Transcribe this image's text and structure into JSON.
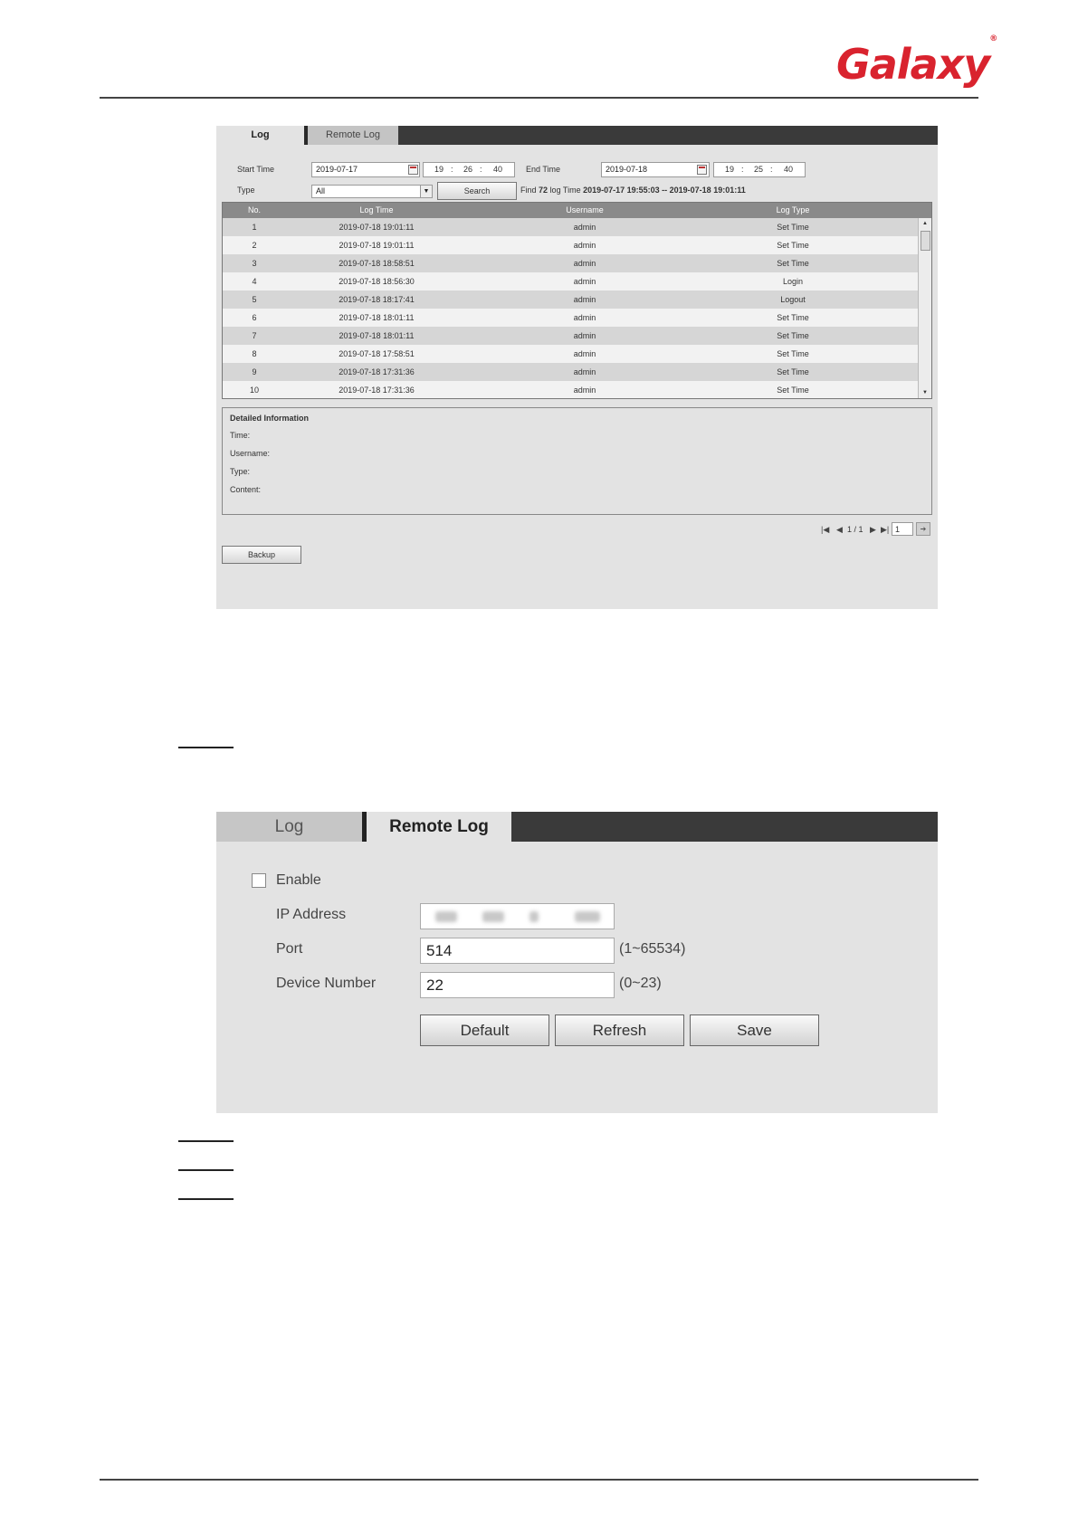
{
  "logo": {
    "text": "Galaxy",
    "mark": "®"
  },
  "log_panel": {
    "tabs": [
      "Log",
      "Remote Log"
    ],
    "start_time_label": "Start Time",
    "start_date": "2019-07-17",
    "start_time": {
      "h": "19",
      "m": "26",
      "s": "40"
    },
    "end_time_label": "End Time",
    "end_date": "2019-07-18",
    "end_time": {
      "h": "19",
      "m": "25",
      "s": "40"
    },
    "type_label": "Type",
    "type_value": "All",
    "search_label": "Search",
    "find_prefix": "Find",
    "find_count": "72",
    "find_middle": "log Time",
    "find_range": "2019-07-17 19:55:03 -- 2019-07-18 19:01:11",
    "columns": [
      "No.",
      "Log Time",
      "Username",
      "Log Type"
    ],
    "rows": [
      [
        "1",
        "2019-07-18 19:01:11",
        "admin",
        "Set Time"
      ],
      [
        "2",
        "2019-07-18 19:01:11",
        "admin",
        "Set Time"
      ],
      [
        "3",
        "2019-07-18 18:58:51",
        "admin",
        "Set Time"
      ],
      [
        "4",
        "2019-07-18 18:56:30",
        "admin",
        "Login"
      ],
      [
        "5",
        "2019-07-18 18:17:41",
        "admin",
        "Logout"
      ],
      [
        "6",
        "2019-07-18 18:01:11",
        "admin",
        "Set Time"
      ],
      [
        "7",
        "2019-07-18 18:01:11",
        "admin",
        "Set Time"
      ],
      [
        "8",
        "2019-07-18 17:58:51",
        "admin",
        "Set Time"
      ],
      [
        "9",
        "2019-07-18 17:31:36",
        "admin",
        "Set Time"
      ],
      [
        "10",
        "2019-07-18 17:31:36",
        "admin",
        "Set Time"
      ]
    ],
    "detail": {
      "title": "Detailed Information",
      "time": "Time:",
      "username": "Username:",
      "type": "Type:",
      "content": "Content:"
    },
    "pager": {
      "text": "1 / 1",
      "page_input": "1"
    },
    "backup_label": "Backup"
  },
  "remote_panel": {
    "tabs": [
      "Log",
      "Remote Log"
    ],
    "enable_label": "Enable",
    "enable_checked": false,
    "ip_label": "IP Address",
    "port_label": "Port",
    "port_value": "514",
    "port_range": "(1~65534)",
    "device_label": "Device Number",
    "device_value": "22",
    "device_range": "(0~23)",
    "buttons": {
      "default": "Default",
      "refresh": "Refresh",
      "save": "Save"
    }
  },
  "colors": {
    "brand": "#d9232e",
    "tabbar": "#3a3a3a",
    "panel": "#e3e3e3"
  }
}
